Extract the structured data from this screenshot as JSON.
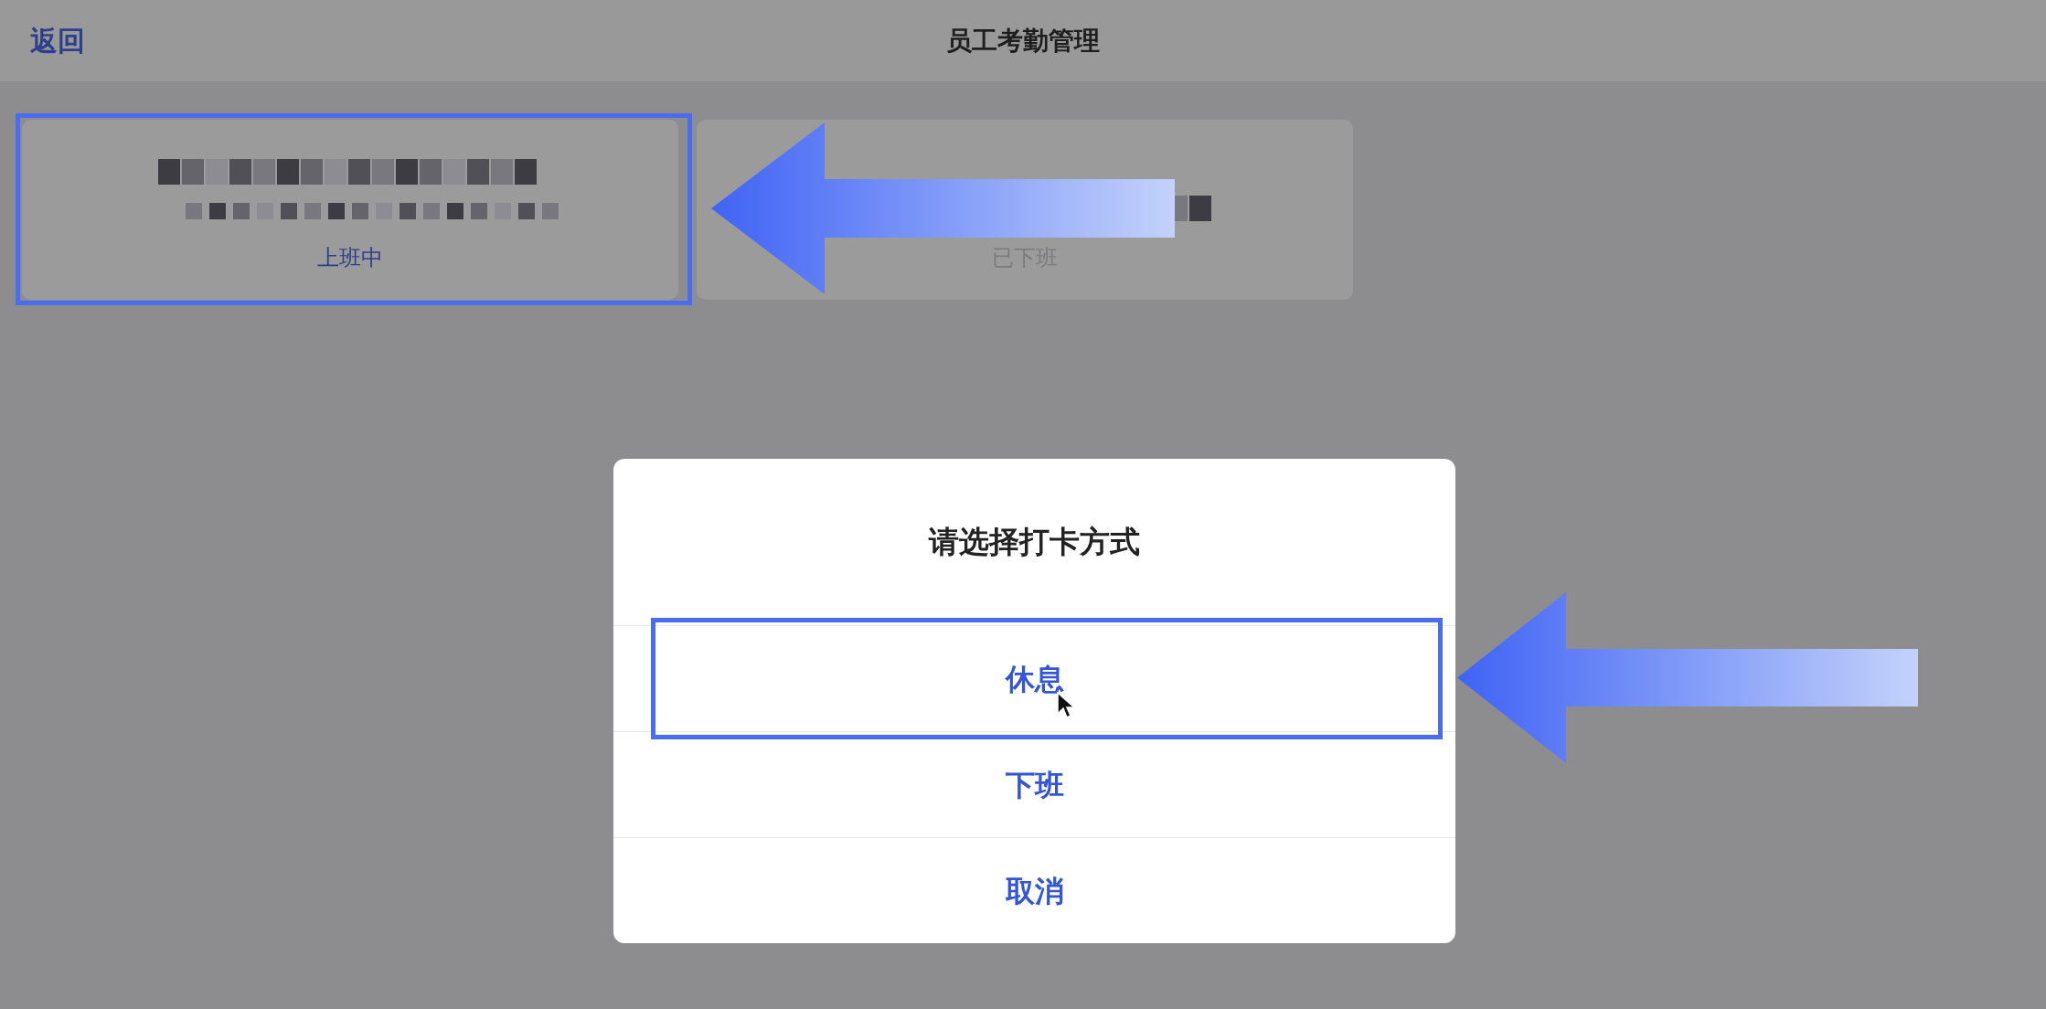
{
  "nav": {
    "back": "返回",
    "title": "员工考勤管理"
  },
  "employees": [
    {
      "status": "上班中",
      "color": "#2c3f8a",
      "highlighted": true
    },
    {
      "status": "已下班",
      "color": "#7b7b7d",
      "highlighted": false
    }
  ],
  "dialog": {
    "title": "请选择打卡方式",
    "options": [
      {
        "label": "休息",
        "highlighted": true
      },
      {
        "label": "下班",
        "highlighted": false
      },
      {
        "label": "取消",
        "highlighted": false
      }
    ]
  }
}
